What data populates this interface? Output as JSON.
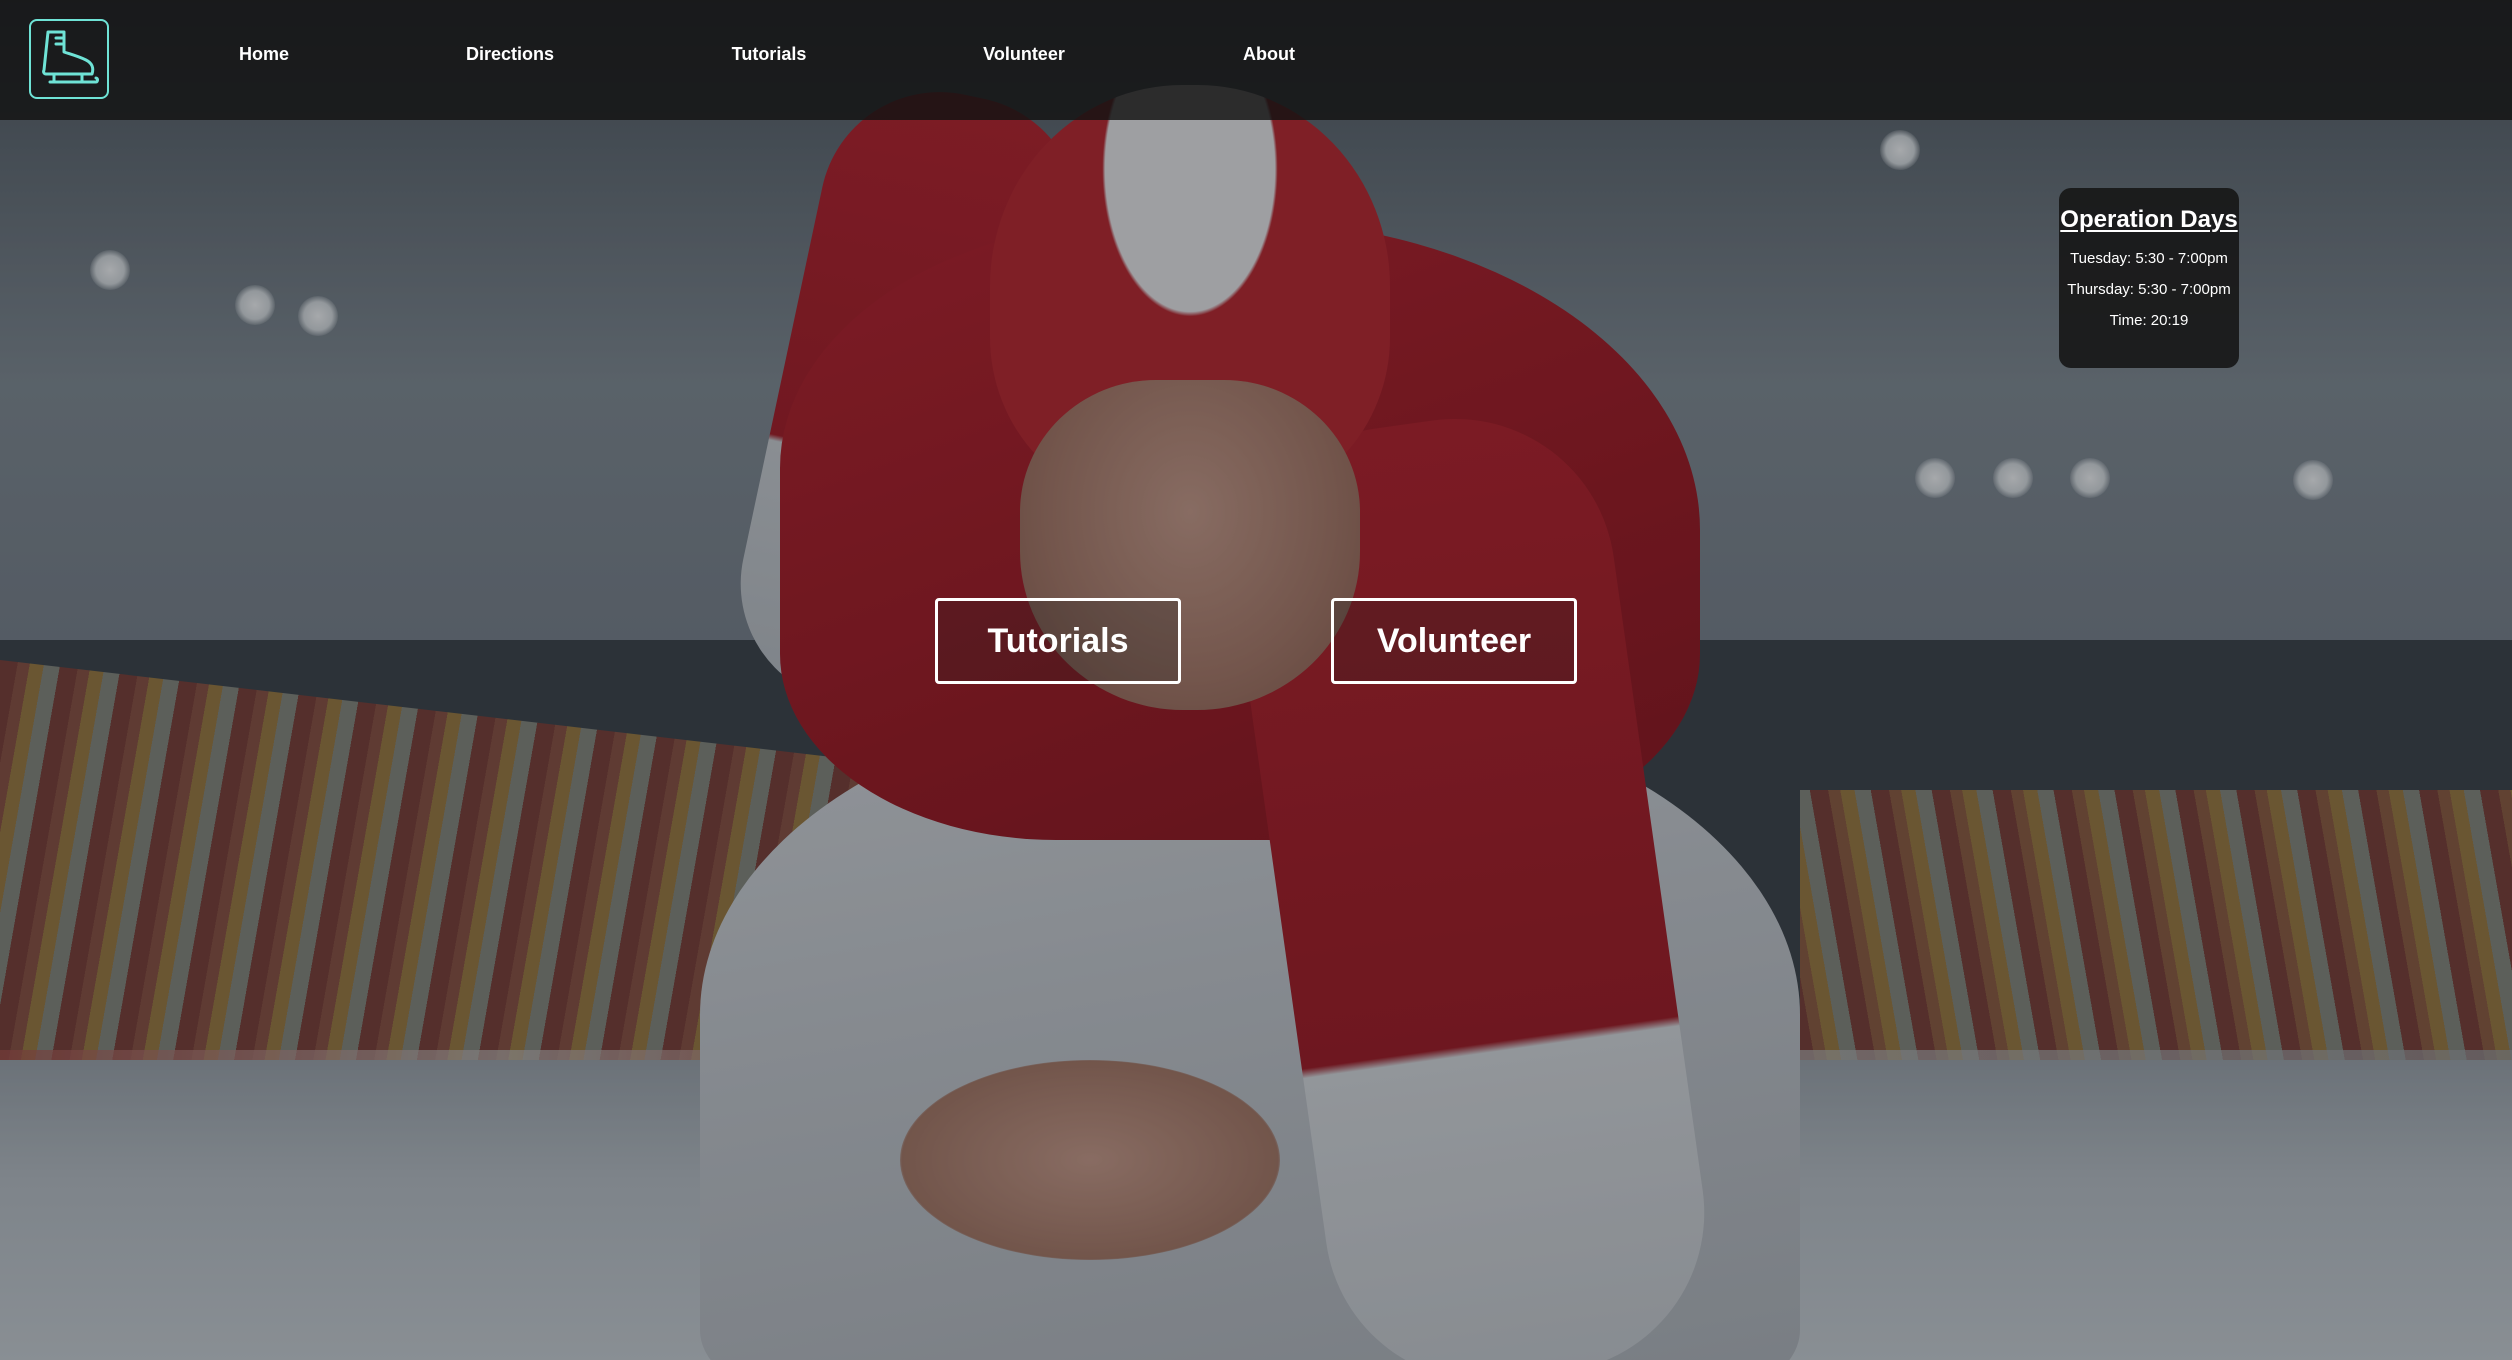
{
  "brand": {
    "logo_icon": "ice-skate-icon",
    "accent": "#6fe3d6"
  },
  "nav": {
    "items": [
      {
        "label": "Home"
      },
      {
        "label": "Directions"
      },
      {
        "label": "Tutorials"
      },
      {
        "label": "Volunteer"
      },
      {
        "label": "About"
      }
    ]
  },
  "operation_days": {
    "title": "Operation Days",
    "lines": [
      "Tuesday: 5:30 - 7:00pm",
      "Thursday: 5:30 - 7:00pm",
      "Time: 20:19"
    ]
  },
  "hero": {
    "background": "speed-skater-photo",
    "buttons": [
      {
        "label": "Tutorials"
      },
      {
        "label": "Volunteer"
      }
    ]
  }
}
